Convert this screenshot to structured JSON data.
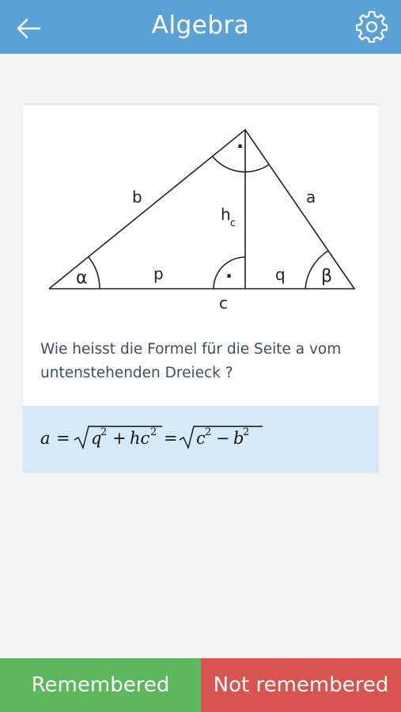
{
  "header": {
    "title": "Algebra",
    "back_icon": "arrow-left-icon",
    "settings_icon": "gear-icon",
    "background": "#5aa2d6"
  },
  "card": {
    "diagram": {
      "side_labels": {
        "b": "b",
        "a": "a",
        "c": "c",
        "p": "p",
        "q": "q"
      },
      "height_label": "h",
      "height_subscript": "c",
      "angles": {
        "alpha": "α",
        "beta": "β"
      },
      "right_angle_mark": "·"
    },
    "question": "Wie heisst die Formel für die Seite a vom untenstehenden Dreieck ?",
    "answer": {
      "formula_text": "a = √(q² + hc²) = √(c² − b²)",
      "background": "#d6e9f7"
    }
  },
  "footer": {
    "remembered_label": "Remembered",
    "not_remembered_label": "Not remembered",
    "remembered_color": "#5cb85c",
    "not_remembered_color": "#d9534f"
  }
}
